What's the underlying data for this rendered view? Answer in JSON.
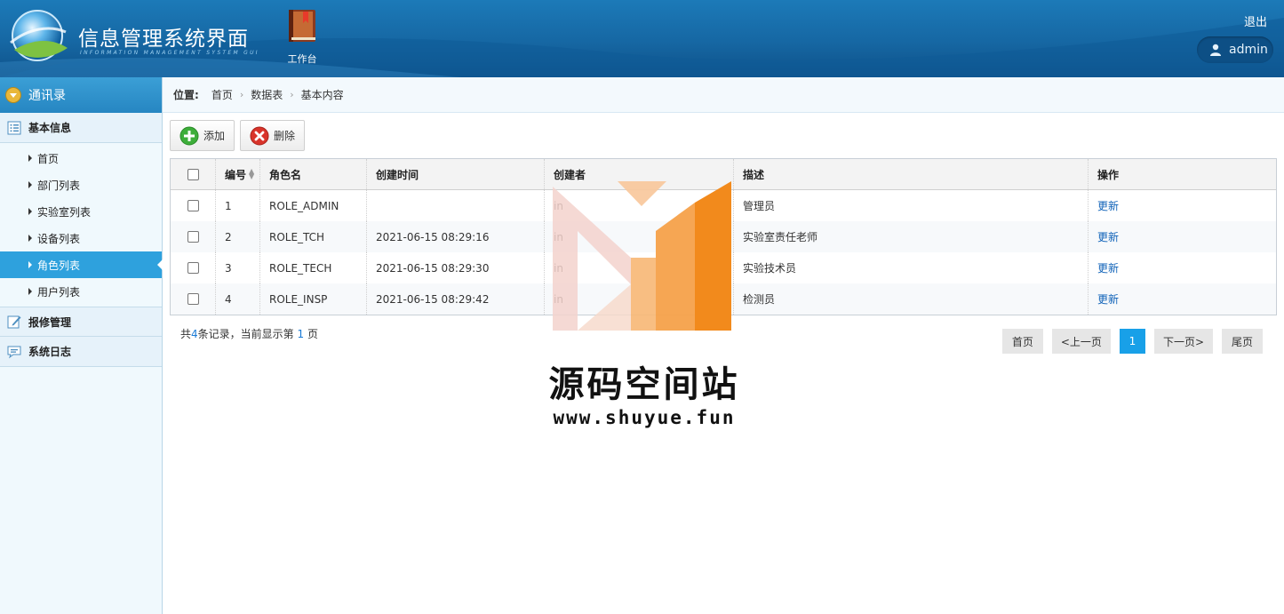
{
  "header": {
    "title": "信息管理系统界面",
    "subtitle": "INFORMATION MANAGEMENT SYSTEM GUI",
    "workbench_label": "工作台",
    "logout_label": "退出",
    "username": "admin"
  },
  "sidebar": {
    "top_label": "通讯录",
    "groups": [
      {
        "label": "基本信息",
        "icon": "list-icon"
      },
      {
        "label": "报修管理",
        "icon": "edit-icon"
      },
      {
        "label": "系统日志",
        "icon": "message-icon"
      }
    ],
    "items": [
      {
        "label": "首页"
      },
      {
        "label": "部门列表"
      },
      {
        "label": "实验室列表"
      },
      {
        "label": "设备列表"
      },
      {
        "label": "角色列表",
        "active": true
      },
      {
        "label": "用户列表"
      }
    ]
  },
  "breadcrumb": {
    "label": "位置:",
    "items": [
      "首页",
      "数据表",
      "基本内容"
    ]
  },
  "toolbar": {
    "add_label": "添加",
    "delete_label": "删除"
  },
  "table": {
    "columns": [
      "编号",
      "角色名",
      "创建时间",
      "创建者",
      "描述",
      "操作"
    ],
    "rows": [
      {
        "id": "1",
        "name": "ROLE_ADMIN",
        "time": "",
        "creator": "in",
        "desc": "管理员",
        "op": "更新"
      },
      {
        "id": "2",
        "name": "ROLE_TCH",
        "time": "2021-06-15 08:29:16",
        "creator": "in",
        "desc": "实验室责任老师",
        "op": "更新"
      },
      {
        "id": "3",
        "name": "ROLE_TECH",
        "time": "2021-06-15 08:29:30",
        "creator": "in",
        "desc": "实验技术员",
        "op": "更新"
      },
      {
        "id": "4",
        "name": "ROLE_INSP",
        "time": "2021-06-15 08:29:42",
        "creator": "in",
        "desc": "检测员",
        "op": "更新"
      }
    ]
  },
  "pager": {
    "info_prefix": "共",
    "total": "4",
    "info_mid": "条记录，当前显示第",
    "page": "1",
    "info_suffix": "页",
    "first": "首页",
    "prev": "<上一页",
    "current": "1",
    "next": "下一页>",
    "last": "尾页"
  },
  "watermark": {
    "text": "源码空间站",
    "url": "www.shuyue.fun"
  },
  "colors": {
    "header_blue": "#1667a3",
    "active_item": "#2ea1dd",
    "pager_current": "#18a0e8",
    "link": "#0f62b8"
  }
}
